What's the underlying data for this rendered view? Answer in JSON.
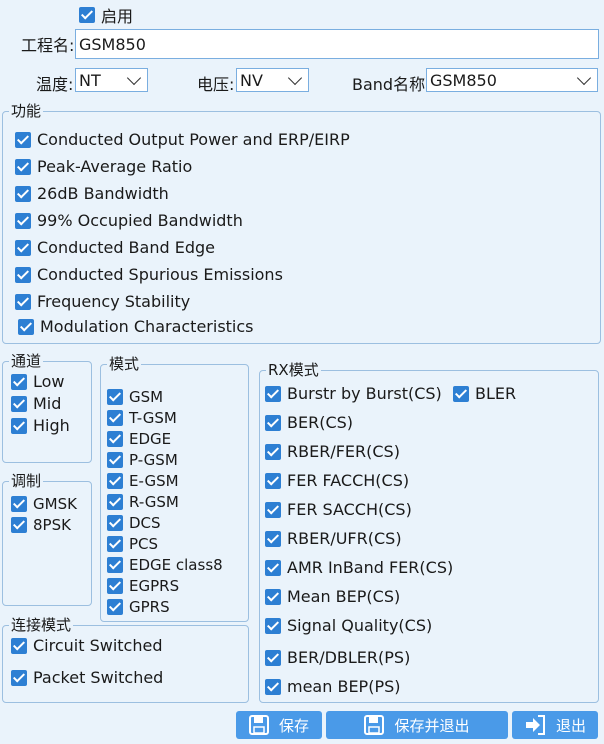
{
  "header": {
    "enable_label": "启用",
    "project_label": "工程名:",
    "project_value": "GSM850",
    "temp_label": "温度:",
    "temp_value": "NT",
    "voltage_label": "电压:",
    "voltage_value": "NV",
    "band_label": "Band名称:",
    "band_value": "GSM850"
  },
  "function_group": {
    "title": "功能",
    "items": [
      "Conducted Output Power and ERP/EIRP",
      "Peak-Average Ratio",
      "26dB Bandwidth",
      "99% Occupied Bandwidth",
      "Conducted Band Edge",
      "Conducted Spurious Emissions",
      "Frequency Stability",
      "Modulation Characteristics"
    ]
  },
  "channel_group": {
    "title": "通道",
    "items": [
      "Low",
      "Mid",
      "High"
    ]
  },
  "modulation_group": {
    "title": "调制",
    "items": [
      "GMSK",
      "8PSK"
    ]
  },
  "mode_group": {
    "title": "模式",
    "items": [
      "GSM",
      "T-GSM",
      "EDGE",
      "P-GSM",
      "E-GSM",
      "R-GSM",
      "DCS",
      "PCS",
      "EDGE class8",
      "EGPRS",
      "GPRS"
    ]
  },
  "connect_group": {
    "title": "连接模式",
    "items": [
      "Circuit Switched",
      "Packet Switched"
    ]
  },
  "rx_group": {
    "title": "RX模式",
    "items": [
      "Burstr by Burst(CS)",
      "BLER",
      "BER(CS)",
      "RBER/FER(CS)",
      "FER FACCH(CS)",
      "FER SACCH(CS)",
      "RBER/UFR(CS)",
      "AMR InBand FER(CS)",
      "Mean BEP(CS)",
      "Signal Quality(CS)",
      "BER/DBLER(PS)",
      "mean BEP(PS)"
    ]
  },
  "buttons": {
    "save": "保存",
    "save_exit": "保存并退出",
    "exit": "退出"
  }
}
